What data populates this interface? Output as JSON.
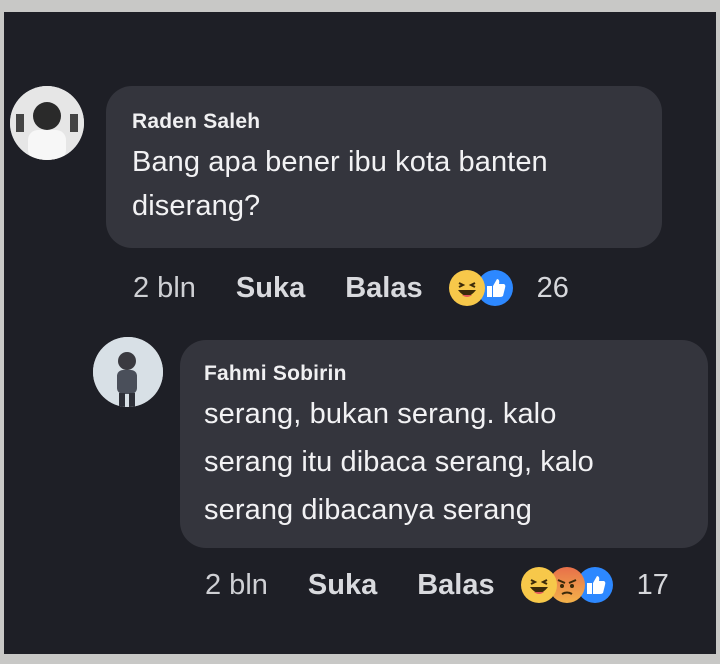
{
  "comments": [
    {
      "author": "Raden Saleh",
      "text_lines": [
        "Bang apa bener ibu kota banten",
        "diserang?"
      ],
      "time": "2 bln",
      "like_label": "Suka",
      "reply_label": "Balas",
      "reactions": [
        "haha-icon",
        "like-icon"
      ],
      "reaction_count": "26"
    },
    {
      "author": "Fahmi Sobirin",
      "text_lines": [
        "serang, bukan serang. kalo",
        "serang itu dibaca serang, kalo",
        "serang dibacanya serang"
      ],
      "time": "2 bln",
      "like_label": "Suka",
      "reply_label": "Balas",
      "reactions": [
        "haha-icon",
        "angry-icon",
        "like-icon"
      ],
      "reaction_count": "17"
    }
  ],
  "colors": {
    "background": "#1e1f26",
    "bubble": "#34353d",
    "haha": "#f7c84a",
    "angry": "#e8704a",
    "like": "#2d88ff"
  }
}
